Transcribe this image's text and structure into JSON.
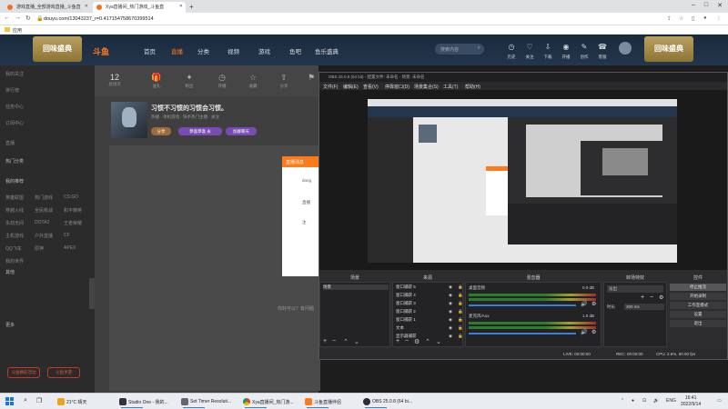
{
  "browser": {
    "tabs": [
      {
        "label": "游戏直播_全部游戏直播_斗鱼直"
      },
      {
        "label": "Xya直播间_热门游戏_斗鱼直"
      }
    ],
    "url": "douyu.com/13043237_r=0.417154758670399514",
    "bookmark": "应用"
  },
  "douyu": {
    "banner_left": "回味盛典",
    "banner_right": "回味盛典",
    "logo": "斗鱼",
    "nav": [
      "首页",
      "直播",
      "分类",
      "视频",
      "游戏",
      "鱼吧",
      "鱼乐盛典"
    ],
    "search_placeholder": "搜索内容",
    "header_icons": [
      "历史",
      "关注",
      "下载",
      "开播",
      "创作",
      "客服"
    ]
  },
  "sidebar": {
    "items": [
      "我的关注",
      "排行榜",
      "任务中心",
      "订阅中心",
      "直播"
    ],
    "section_hot": "热门分类",
    "section_recommend": "我的推荐",
    "games": [
      "英雄联盟",
      "热门游戏",
      "CS:GO",
      "穿越火线",
      "全民枪战",
      "和平精英",
      "永劫无间",
      "DOTA2",
      "王者荣耀",
      "主机游戏",
      "户外直播",
      "CF",
      "QQ飞车",
      "原神",
      "APEX",
      "我的世界"
    ],
    "section_other": "其他",
    "section_more": "更多",
    "btn_left": "斗鱼精彩活动",
    "btn_right": "斗鱼手游"
  },
  "room": {
    "stats": [
      {
        "num": "12",
        "label": "总场次"
      }
    ],
    "icons": [
      "送礼",
      "粉丝",
      "开播",
      "收藏",
      "分享",
      "举报"
    ],
    "title": "习惯不习惯的习惯会习惯。",
    "meta": "热播 · 单机游戏 · 快手热门主播 · 关注",
    "pill_a": "分享",
    "pill_b": "恭喜恭喜 永",
    "pill_c": "加群聊天"
  },
  "popup": {
    "header": "直播消息",
    "lines": [
      "dong",
      "直播",
      "注"
    ]
  },
  "watermark": "你好可以？有问题",
  "obs": {
    "title": "OBS 25.0.8 (64 bit) - 配置文件: 未命名 - 场景: 未命名",
    "menu": [
      "文件(F)",
      "编辑(E)",
      "查看(V)",
      "停靠窗口(D)",
      "场景集合(S)",
      "工具(T)",
      "帮助(H)"
    ],
    "docks": [
      "场景",
      "来源",
      "混音器",
      "转场特效",
      "控件"
    ],
    "scene": "场景",
    "sources": [
      "窗口捕获 5",
      "窗口捕获 4",
      "窗口捕获 3",
      "窗口捕获 2",
      "窗口捕获 1",
      "文本",
      "显示器捕获"
    ],
    "mixer": [
      {
        "label": "桌面音频",
        "value": "0.0 dB"
      },
      {
        "label": "麦克风/Aux",
        "value": "1.0 dB"
      }
    ],
    "transition": {
      "type": "淡出",
      "duration_label": "时长",
      "duration": "300 ms"
    },
    "controls": [
      "停止推流",
      "开始录制",
      "工作室模式",
      "设置",
      "退出"
    ],
    "status": {
      "live": "LIVE: 00:00:00",
      "rec": "REC: 00:00:00",
      "cpu": "CPU: 2.6%, 60.00 fps"
    }
  },
  "taskbar": {
    "items": [
      {
        "label": "21°C 晴天"
      },
      {
        "label": "Studio One - 我的..."
      },
      {
        "label": "Set Timer Resoluti..."
      },
      {
        "label": "Xya直播间_热门游..."
      },
      {
        "label": "斗鱼直播伴侣"
      },
      {
        "label": "OBS 25.0.8 (64 bi..."
      }
    ],
    "lang": "ENG",
    "time": "16:41",
    "date": "2022/9/14"
  },
  "colors": {
    "accent": "#ff7a1a",
    "obs_bg": "#2d2d30",
    "douyu_header": "#1b2a3d"
  }
}
